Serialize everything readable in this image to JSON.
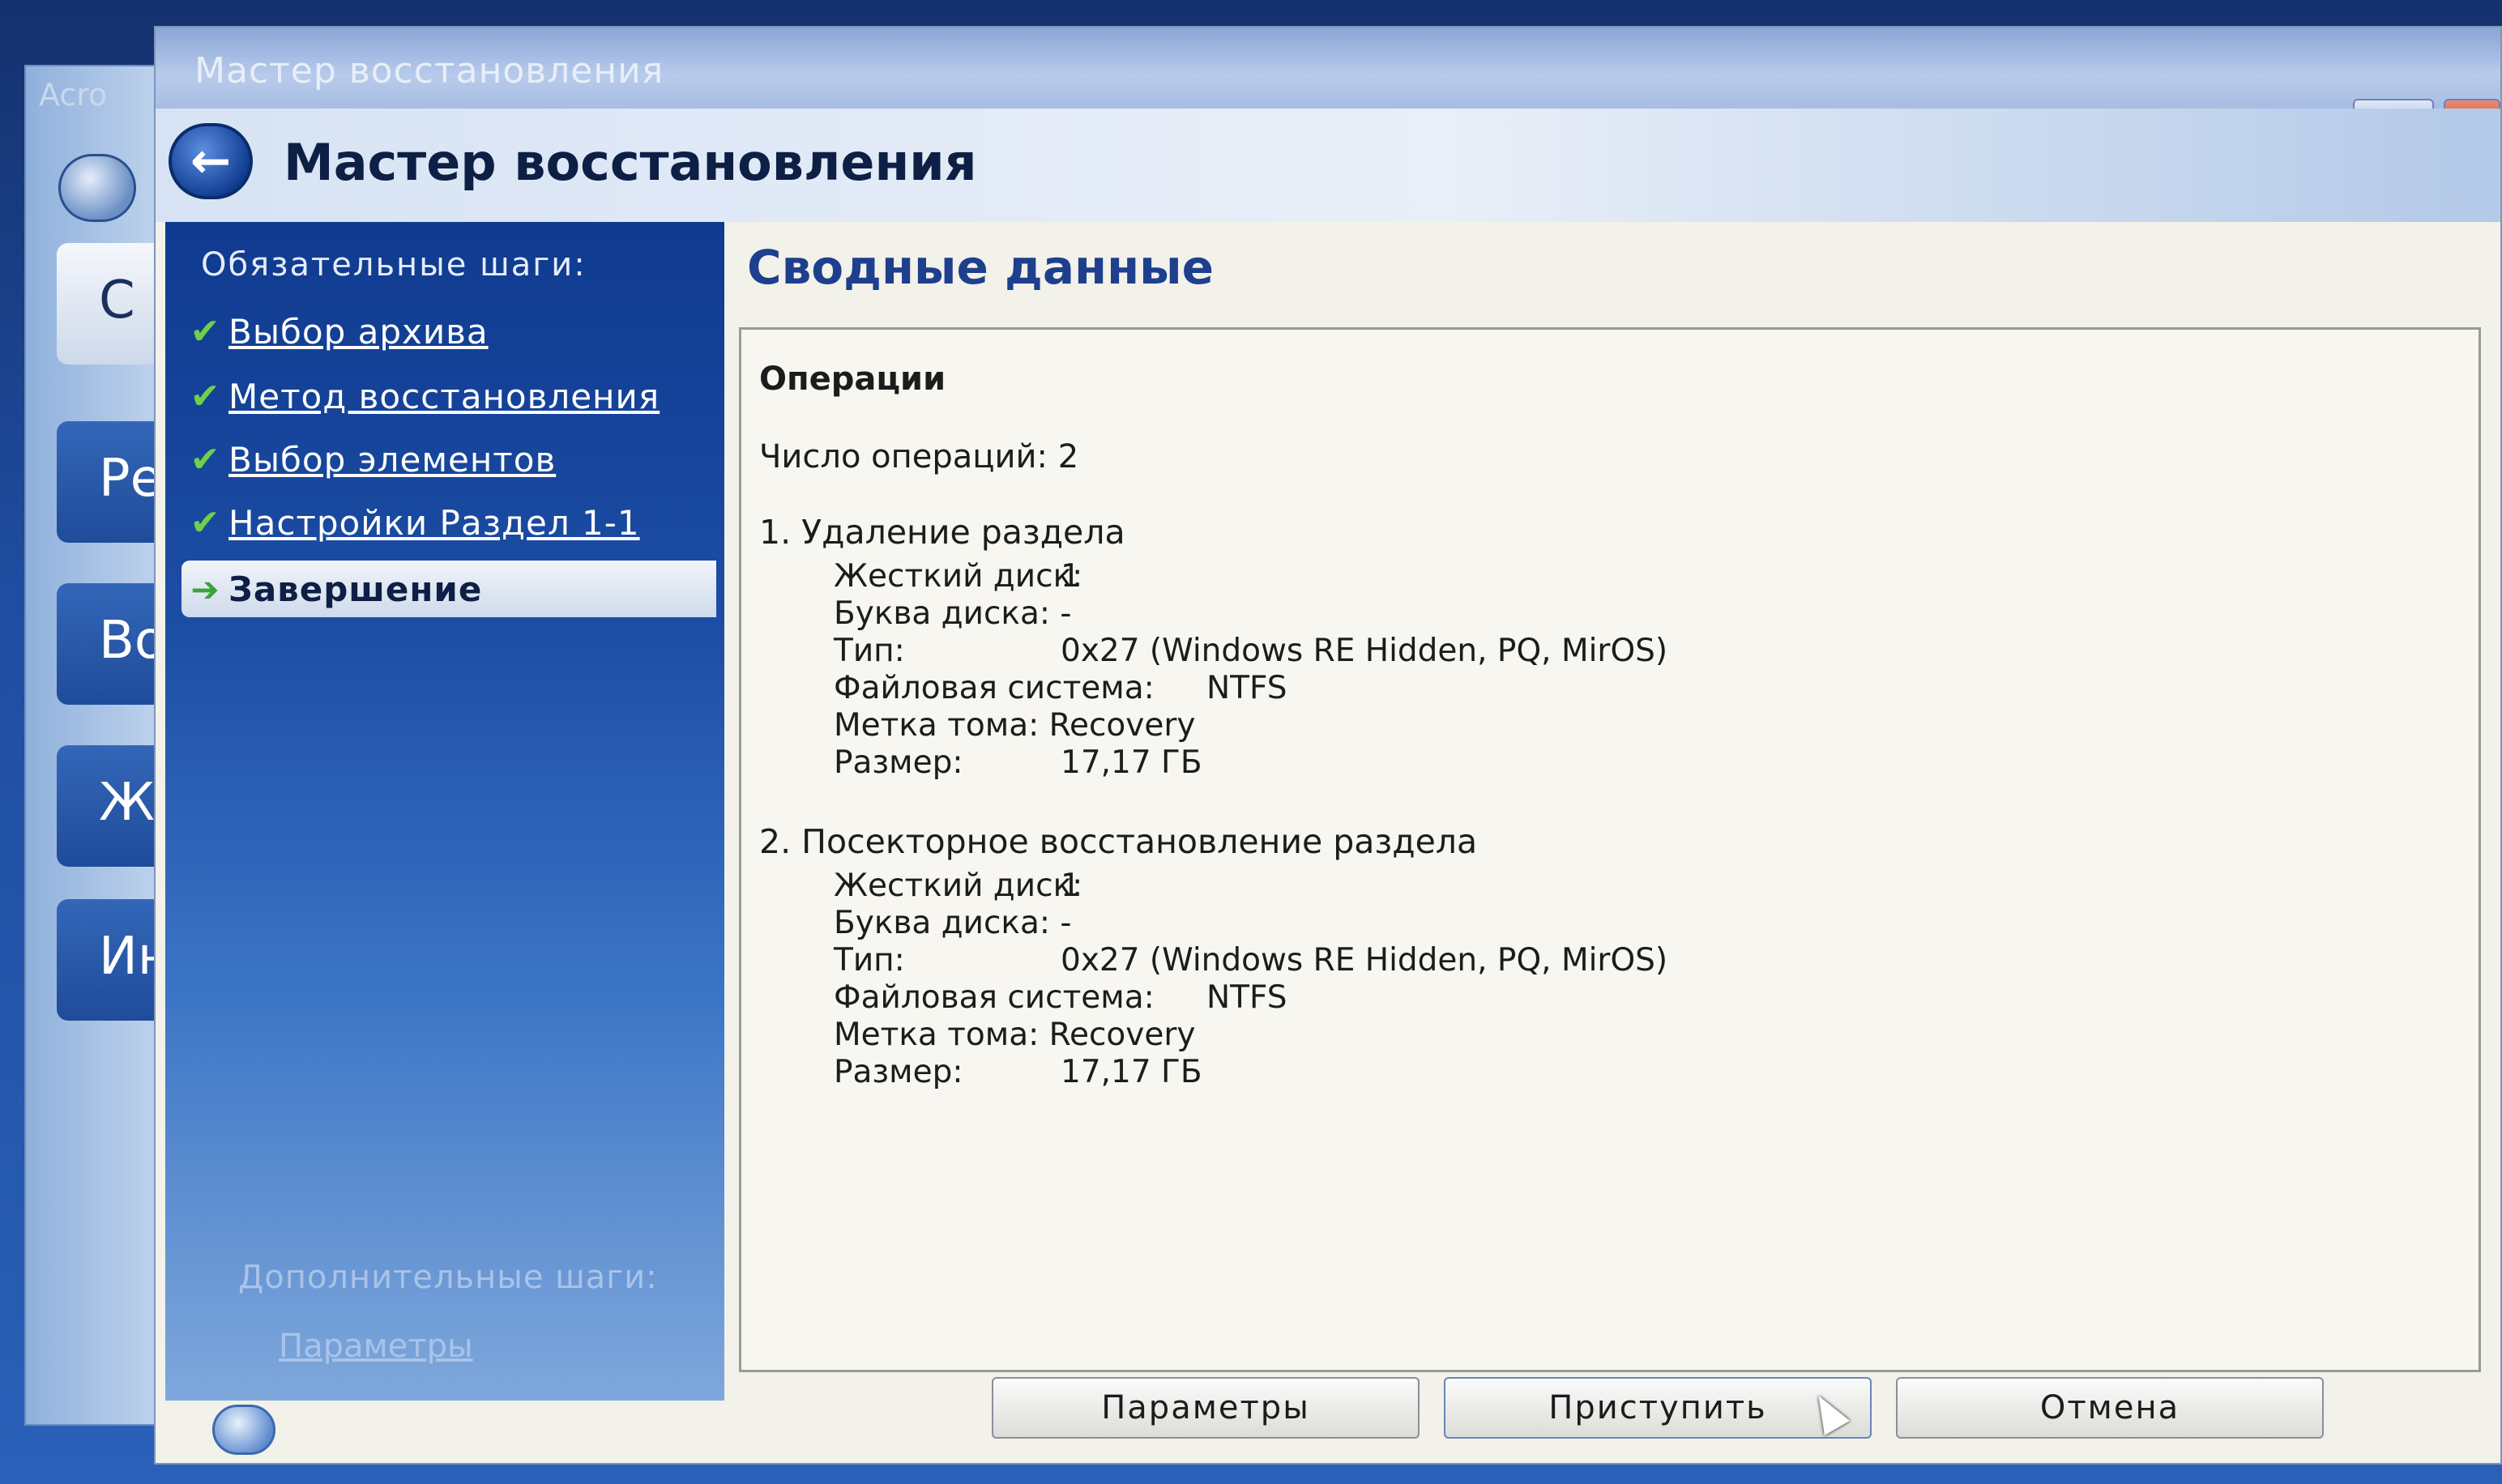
{
  "background_app": {
    "title_fragment": "Acro",
    "items": [
      "С",
      "Ре",
      "Во",
      "Ж",
      "Ин"
    ]
  },
  "window": {
    "title": "Мастер восстановления",
    "header_title": "Мастер восстановления"
  },
  "steps": {
    "required_label": "Обязательные шаги:",
    "items": [
      {
        "label": "Выбор архива",
        "done": true
      },
      {
        "label": "Метод восстановления",
        "done": true
      },
      {
        "label": "Выбор элементов",
        "done": true
      },
      {
        "label": "Настройки Раздел 1-1",
        "done": true
      }
    ],
    "current": "Завершение",
    "optional_label": "Дополнительные шаги:",
    "optional_link": "Параметры"
  },
  "summary": {
    "title": "Сводные данные",
    "operations_header": "Операции",
    "count_text": "Число операций: 2",
    "operations": [
      {
        "title": "1. Удаление раздела",
        "disk_key": "Жесткий диск:",
        "disk_val": "1",
        "letter_text": "Буква диска: -",
        "type_key": "Тип:",
        "type_val": "0x27 (Windows RE Hidden, PQ, MirOS)",
        "fs_key": "Файловая система:",
        "fs_val": "NTFS",
        "label_text": "Метка тома: Recovery",
        "size_key": "Размер:",
        "size_val": "17,17 ГБ"
      },
      {
        "title": "2. Посекторное восстановление раздела",
        "disk_key": "Жесткий диск:",
        "disk_val": "1",
        "letter_text": "Буква диска: -",
        "type_key": "Тип:",
        "type_val": "0x27 (Windows RE Hidden, PQ, MirOS)",
        "fs_key": "Файловая система:",
        "fs_val": "NTFS",
        "label_text": "Метка тома: Recovery",
        "size_key": "Размер:",
        "size_val": "17,17 ГБ"
      }
    ]
  },
  "footer": {
    "options_label": "Параметры",
    "proceed_label": "Приступить",
    "cancel_label": "Отмена"
  }
}
